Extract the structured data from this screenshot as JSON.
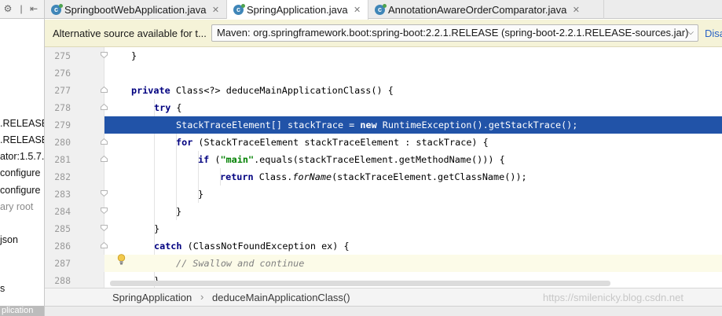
{
  "tabs": [
    {
      "label": "SpringbootWebApplication.java",
      "active": false
    },
    {
      "label": "SpringApplication.java",
      "active": true
    },
    {
      "label": "AnnotationAwareOrderComparator.java",
      "active": false
    }
  ],
  "banner": {
    "message": "Alternative source available for t...",
    "selected_source": "Maven: org.springframework.boot:spring-boot:2.2.1.RELEASE (spring-boot-2.2.1.RELEASE-sources.jar)",
    "link": "Disa"
  },
  "project_tree_fragments": [
    ".RELEASE",
    ".RELEASE",
    "ator:1.5.7.",
    "configure",
    "configure",
    "ary root",
    "json",
    "s"
  ],
  "left_bottom_tab": "plication",
  "code_lines": [
    {
      "num": "275",
      "text": "}"
    },
    {
      "num": "276",
      "text": ""
    },
    {
      "num": "277",
      "text": "private Class<?> deduceMainApplicationClass() {"
    },
    {
      "num": "278",
      "text": "try {"
    },
    {
      "num": "279",
      "text": "StackTraceElement[] stackTrace = new RuntimeException().getStackTrace();"
    },
    {
      "num": "280",
      "text": "for (StackTraceElement stackTraceElement : stackTrace) {"
    },
    {
      "num": "281",
      "text": "if (\"main\".equals(stackTraceElement.getMethodName())) {"
    },
    {
      "num": "282",
      "text": "return Class.forName(stackTraceElement.getClassName());"
    },
    {
      "num": "283",
      "text": "}"
    },
    {
      "num": "284",
      "text": "}"
    },
    {
      "num": "285",
      "text": "}"
    },
    {
      "num": "286",
      "text": "catch (ClassNotFoundException ex) {"
    },
    {
      "num": "287",
      "text": "// Swallow and continue"
    },
    {
      "num": "288",
      "text": "}"
    }
  ],
  "highlighted_line": "279",
  "caret_line": "287",
  "breadcrumb": [
    "SpringApplication",
    "deduceMainApplicationClass()"
  ],
  "breadcrumb_separator": "›",
  "watermark": "https://smilenicky.blog.csdn.net",
  "icons": {
    "tab_icon": "java-class-icon",
    "banner_chevron": "chevron-down-icon",
    "bulb": "lightbulb-icon"
  },
  "colors": {
    "selection": "#2153a8",
    "banner_bg": "#f5f3d8",
    "keyword": "#000080",
    "string": "#008000",
    "comment": "#808080"
  }
}
